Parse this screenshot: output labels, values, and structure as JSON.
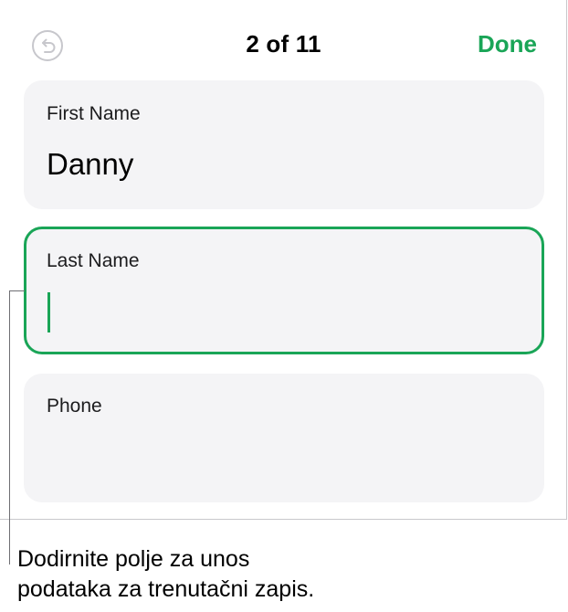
{
  "header": {
    "undo_icon": "undo-arrow-icon",
    "counter": "2 of 11",
    "done_label": "Done"
  },
  "fields": [
    {
      "label": "First Name",
      "value": "Danny"
    },
    {
      "label": "Last Name",
      "value": ""
    },
    {
      "label": "Phone",
      "value": ""
    }
  ],
  "callout": {
    "line1": "Dodirnite polje za unos",
    "line2": "podataka za trenutačni zapis."
  },
  "colors": {
    "accent": "#1aa557",
    "field_background": "#f4f4f6",
    "undo_disabled": "#c7c7cc"
  }
}
